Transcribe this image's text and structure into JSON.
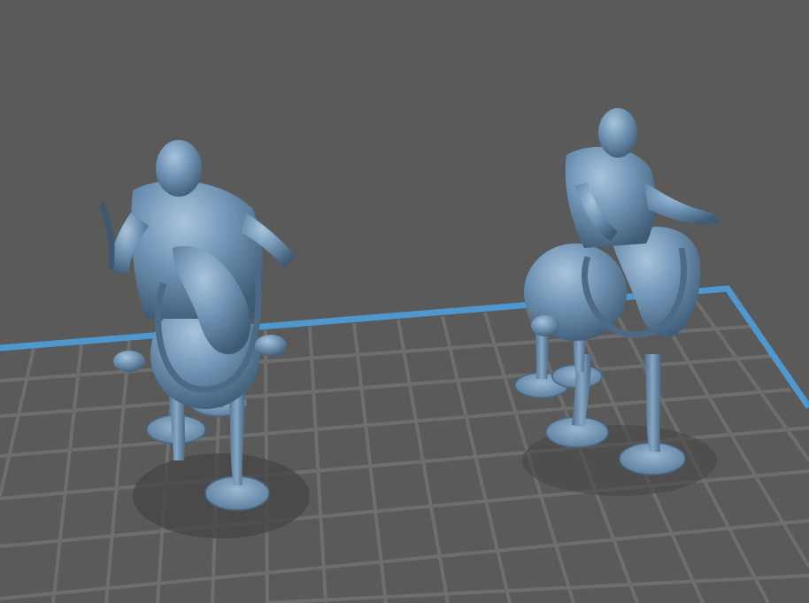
{
  "viewport": {
    "background_color": "#5a5a5a",
    "grid_line_color": "#6c6c6c",
    "build_plate_edge_color": "#4f97cf",
    "model_color": "#6d90b0",
    "model_highlight_color": "#9cbbd6",
    "model_shadow_color": "#3f5870"
  },
  "models": [
    {
      "name": "mounted-officer-with-sabre"
    },
    {
      "name": "mounted-officer-gesturing"
    }
  ]
}
